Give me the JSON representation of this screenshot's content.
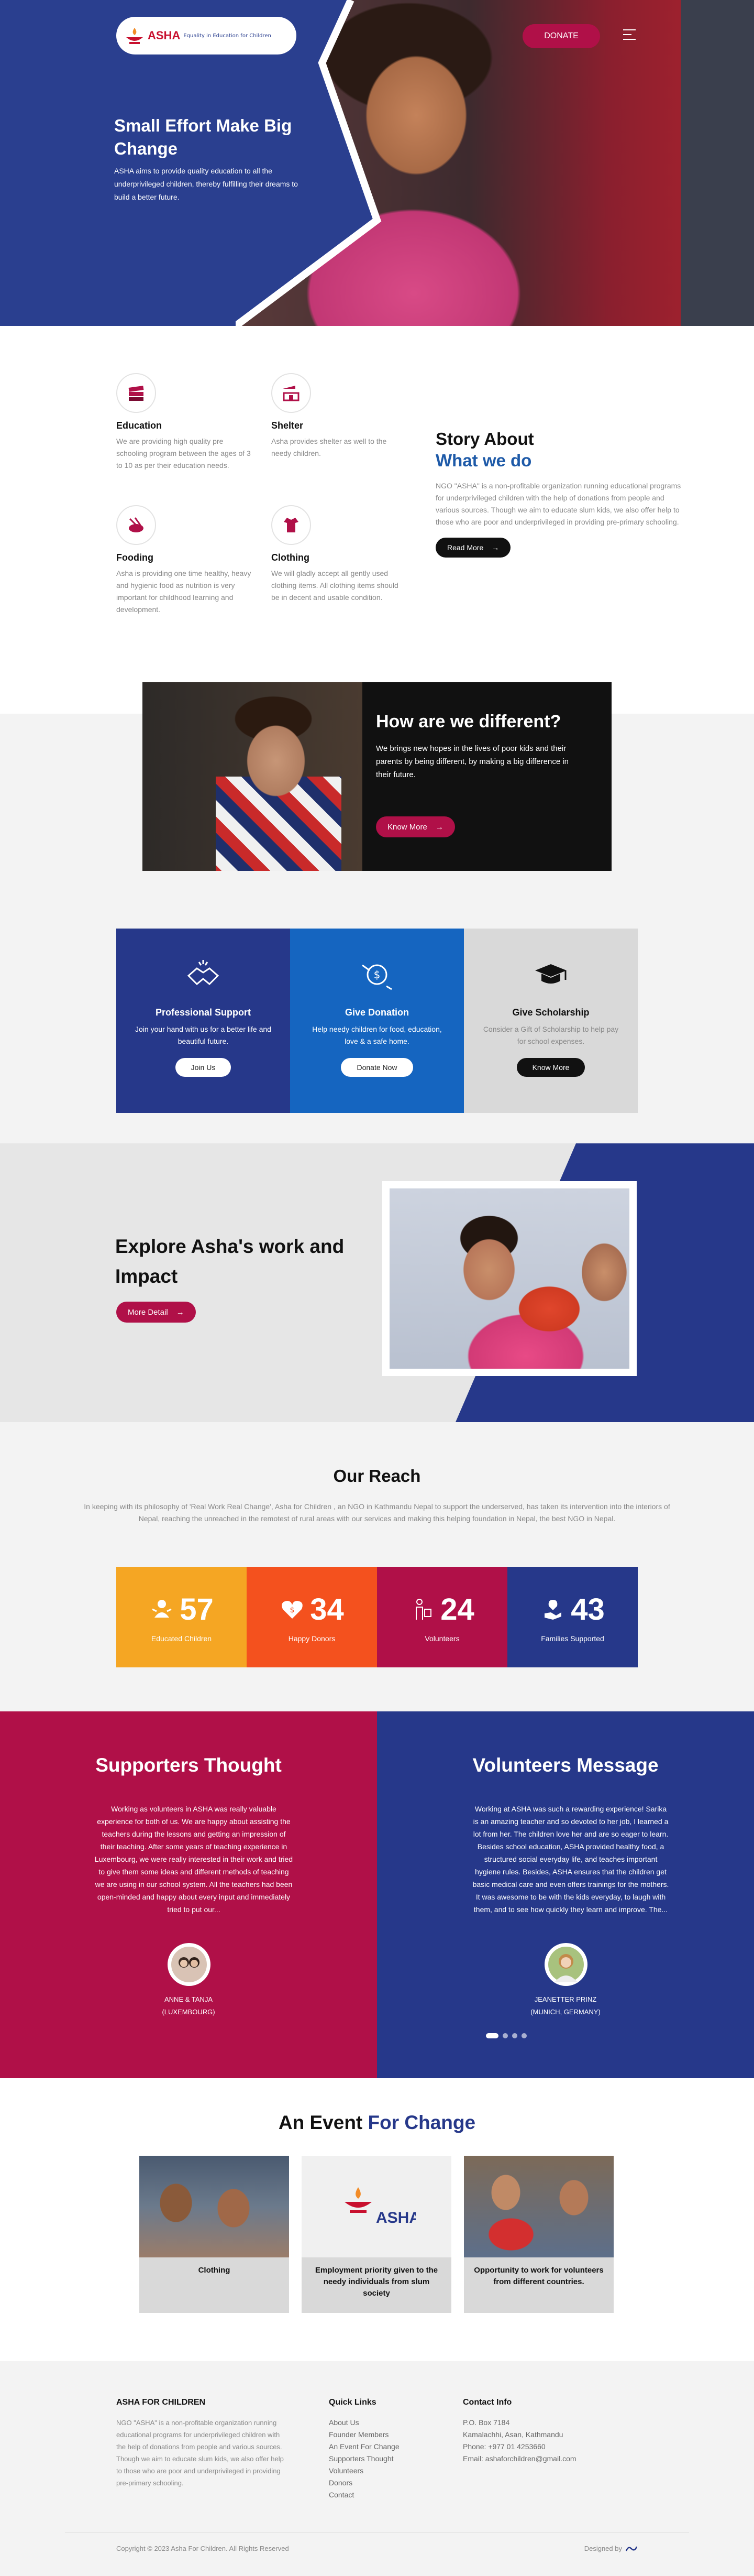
{
  "header": {
    "logo_text": "ASHA",
    "logo_tagline": "Equality in Education for Children",
    "donate_label": "DONATE"
  },
  "hero": {
    "title": "Small Effort Make Big Change",
    "text": "ASHA aims to provide quality education to all the underprivileged children, thereby fulfilling their dreams to build a better future."
  },
  "services": [
    {
      "icon": "books-icon",
      "title": "Education",
      "text": "We are providing high quality pre schooling program between the ages of 3 to 10 as per their education needs."
    },
    {
      "icon": "shelter-icon",
      "title": "Shelter",
      "text": "Asha provides shelter as well to the needy children."
    },
    {
      "icon": "food-icon",
      "title": "Fooding",
      "text": "Asha is providing one time healthy, heavy and hygienic food as nutrition is very important for childhood learning and development."
    },
    {
      "icon": "clothing-icon",
      "title": "Clothing",
      "text": "We will gladly accept all gently used clothing items. All clothing items should be in decent and usable condition."
    }
  ],
  "story": {
    "title": "Story About",
    "subtitle": "What we do",
    "text": "NGO \"ASHA\" is a non-profitable organization running educational programs for underprivileged children with the help of donations from people and various sources. Though we aim to educate slum kids, we also offer help to those who are poor and underprivileged in providing pre-primary schooling.",
    "button": "Read More"
  },
  "different": {
    "title": "How are we different?",
    "text": "We brings new hopes in the lives of poor kids and their parents by being different, by making a big difference in their future.",
    "button": "Know More"
  },
  "cards": [
    {
      "icon": "handshake-icon",
      "title": "Professional Support",
      "text": "Join your hand with us for a better life and beautiful future.",
      "button": "Join Us",
      "bg": "#26388a"
    },
    {
      "icon": "donation-icon",
      "title": "Give Donation",
      "text": "Help needy children for food, education, love & a safe home.",
      "button": "Donate Now",
      "bg": "#1565c0"
    },
    {
      "icon": "graduation-cap-icon",
      "title": "Give Scholarship",
      "text": "Consider a Gift of Scholarship to help pay for school expenses.",
      "button": "Know More",
      "bg": "#d9d9d9"
    }
  ],
  "explore": {
    "title": "Explore Asha's work and Impact",
    "button": "More Detail"
  },
  "reach": {
    "title": "Our Reach",
    "text": "In keeping with its philosophy of 'Real Work Real Change', Asha for Children , an NGO in Kathmandu Nepal to support the underserved, has taken its intervention into the interiors of Nepal, reaching the unreached in the remotest of rural areas with our services and making this helping foundation in Nepal, the best NGO in Nepal.",
    "stats": [
      {
        "icon": "child-icon",
        "value": "57",
        "label": "Educated Children",
        "color": "#f5a623"
      },
      {
        "icon": "heart-icon",
        "value": "34",
        "label": "Happy Donors",
        "color": "#f4511e"
      },
      {
        "icon": "volunteer-icon",
        "value": "24",
        "label": "Volunteers",
        "color": "#b01048"
      },
      {
        "icon": "family-icon",
        "value": "43",
        "label": "Families Supported",
        "color": "#26388a"
      }
    ]
  },
  "testimonials": [
    {
      "title": "Supporters Thought",
      "text": "Working as volunteers in ASHA was really valuable experience for both of us. We are happy about assisting the teachers during the lessons and getting an impression of their teaching. After some years of teaching experience in Luxembourg, we were really interested in their work and tried to give them some ideas and different methods of teaching we are using in our school system. All the teachers had been open-minded and happy about every input and immediately tried to put our...",
      "name": "ANNE & TANJA",
      "place": "(LUXEMBOURG)",
      "bg": "#b01048"
    },
    {
      "title": "Volunteers Message",
      "text": "Working at ASHA was such a rewarding experience! Sarika is an amazing teacher and so devoted to her job, I learned a lot from her. The children love her and are so eager to learn. Besides school education, ASHA provided healthy food, a structured social everyday life, and teaches important hygiene rules. Besides, ASHA ensures that the children get basic medical care and even offers trainings for the mothers. It was awesome to be with the kids everyday, to laugh with them, and to see how quickly they learn and improve. The...",
      "name": "JEANETTER PRINZ",
      "place": "(MUNICH, GERMANY)",
      "bg": "#26388a"
    }
  ],
  "events": {
    "title_a": "An Event",
    "title_b": "For Change",
    "items": [
      {
        "title": "Clothing"
      },
      {
        "title": "Employment priority given to the needy individuals from slum society"
      },
      {
        "title": "Opportunity to work for volunteers from different countries."
      }
    ]
  },
  "footer": {
    "about_title": "ASHA FOR CHILDREN",
    "about_text": "NGO \"ASHA\" is a non-profitable organization running educational programs for underprivileged children with the help of donations from people and various sources. Though we aim to educate slum kids, we also offer help to those who are poor and underprivileged in providing pre-primary schooling.",
    "links_title": "Quick Links",
    "links": [
      "About Us",
      "Founder Members",
      "An Event For Change",
      "Supporters Thought",
      "Volunteers",
      "Donors",
      "Contact"
    ],
    "contact_title": "Contact Info",
    "contact": [
      "P.O. Box 7184",
      "Kamalachhi, Asan, Kathmandu",
      "Phone: +977 01 4253660",
      "Email: ashaforchildren@gmail.com"
    ],
    "copyright": "Copyright © 2023 Asha For Children. All Rights Reserved",
    "designed_by": "Designed by"
  }
}
